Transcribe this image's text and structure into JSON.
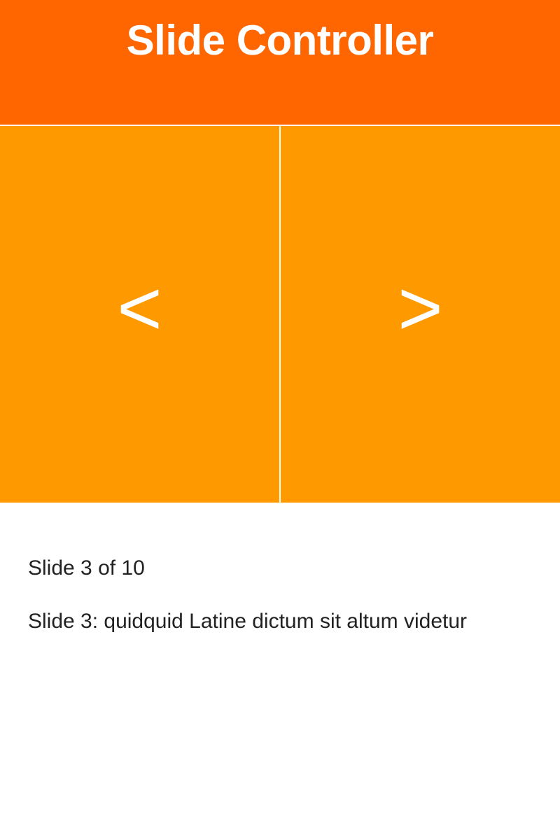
{
  "header": {
    "title": "Slide Controller"
  },
  "controls": {
    "prev_label": "<",
    "next_label": ">"
  },
  "status": {
    "counter": "Slide 3 of 10",
    "caption": "Slide 3: quidquid Latine dictum sit altum videtur"
  },
  "colors": {
    "header_bg": "#ff6600",
    "button_bg": "#ff9900",
    "text": "#222222"
  }
}
